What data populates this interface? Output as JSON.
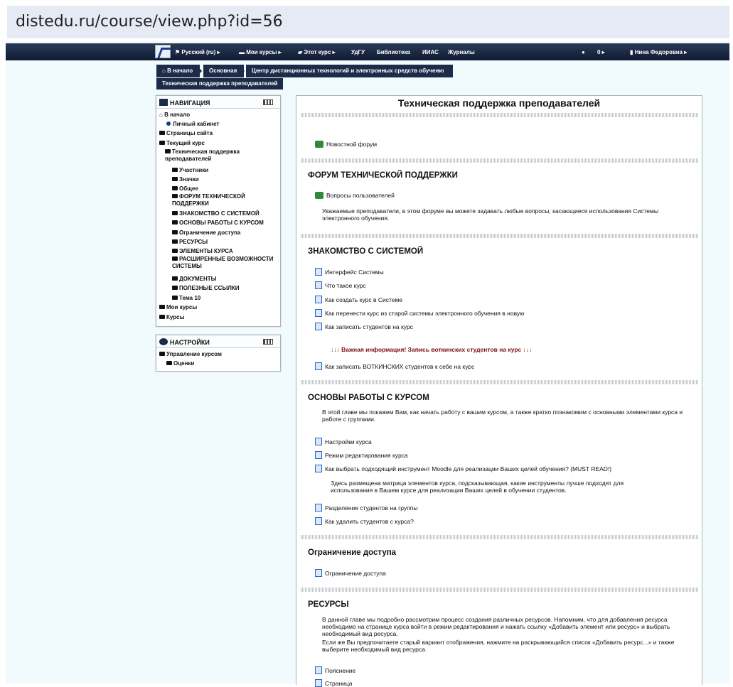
{
  "browser": {
    "url": "distedu.ru/course/view.php?id=56"
  },
  "navbar": {
    "items": [
      "Русский (ru) ▸",
      "Мои курсы ▸",
      "Этот курс ▸",
      "УдГУ",
      "Библиотека",
      "ИИАС",
      "Журналы"
    ],
    "messages": "0 ▸",
    "user": "Нина Федоровна ▸"
  },
  "breadcrumb": [
    "В начало",
    "Основная",
    "Центр дистанционных технологий и электронных средств обучения"
  ],
  "subcrumb": "Техническая поддержка преподавателей",
  "navigation": {
    "title": "НАВИГАЦИЯ",
    "home": "В начало",
    "dashboard": "Личный кабинет",
    "site_pages": "Страницы сайта",
    "current_course": "Текущий курс",
    "course_name": "Техническая поддержка преподавателей",
    "course_items": [
      "Участники",
      "Значки",
      "Общее",
      "ФОРУМ ТЕХНИЧЕСКОЙ ПОДДЕРЖКИ",
      "ЗНАКОМСТВО С СИСТЕМОЙ",
      "ОСНОВЫ РАБОТЫ С КУРСОМ",
      "Ограничение доступа",
      "РЕСУРСЫ",
      "ЭЛЕМЕНТЫ КУРСА",
      "РАСШИРЕННЫЕ ВОЗМОЖНОСТИ СИСТЕМЫ",
      "ДОКУМЕНТЫ",
      "ПОЛЕЗНЫЕ ССЫЛКИ",
      "Тема 10"
    ],
    "my_courses": "Мои курсы",
    "courses": "Курсы"
  },
  "settings": {
    "title": "НАСТРОЙКИ",
    "course_admin": "Управление курсом",
    "grades": "Оценки"
  },
  "main": {
    "title": "Техническая поддержка преподавателей",
    "news_forum": "Новостной форум",
    "forum_section": {
      "title": "ФОРУМ ТЕХНИЧЕСКОЙ ПОДДЕРЖКИ",
      "link": "Вопросы пользователей",
      "text": "Уважаемые преподаватели, в этом форуме вы можете задавать любые вопросы, касающиеся использования Системы электронного обучения."
    },
    "intro_section": {
      "title": "ЗНАКОМСТВО С СИСТЕМОЙ",
      "links": [
        "Интерфейс Системы",
        "Что такое курс",
        "Как создать курс в Системе",
        "Как перенести курс из старой системы электронного обучения в новую",
        "Как записать студентов на курс"
      ],
      "warning": "↓↓↓ Важная информация! Запись воткинских студентов на курс ↓↓↓",
      "votkinsk_link": "Как записать ВОТКИНСКИХ студентов к себе на курс"
    },
    "basics_section": {
      "title": "ОСНОВЫ РАБОТЫ С КУРСОМ",
      "text": "В этой главе мы покажем Вам, как начать работу с вашим курсом, а также кратко познакомим с основными элементами курса и работе с группами.",
      "links": [
        "Настройки курса",
        "Режим редактирования курса",
        "Как выбрать подходящий инструмент Moodle для реализации Ваших целей обучения? (MUST READ!)"
      ],
      "matrix_text": "Здесь размещена матрица элементов курса, подсказывающая, какие инструменты лучше подходят для использования в Вашем курсе для реализации Ваших целей в обучении студентов.",
      "links2": [
        "Разделение студентов на группы",
        "Как удалить студентов с курса?"
      ]
    },
    "access_section": {
      "title": "Ограничение доступа",
      "link": "Ограничение доступа"
    },
    "resources_section": {
      "title": "РЕСУРСЫ",
      "text1": "В данной главе мы подробно рассмотрим процесс создания различных ресурсов. Напомним, что для добавления ресурса необходимо на странице курса войти в режим редактирования и нажать ссылку «Добавить элемент или ресурс» и выбрать необходимый вид ресурса.",
      "text2": "Если же Вы предпочитаете старый вариант отображения, нажмите на раскрывающийся список «Добавить ресурс...» и также выберите необходимый вид ресурса.",
      "links": [
        "Пояснение",
        "Страница"
      ]
    }
  }
}
